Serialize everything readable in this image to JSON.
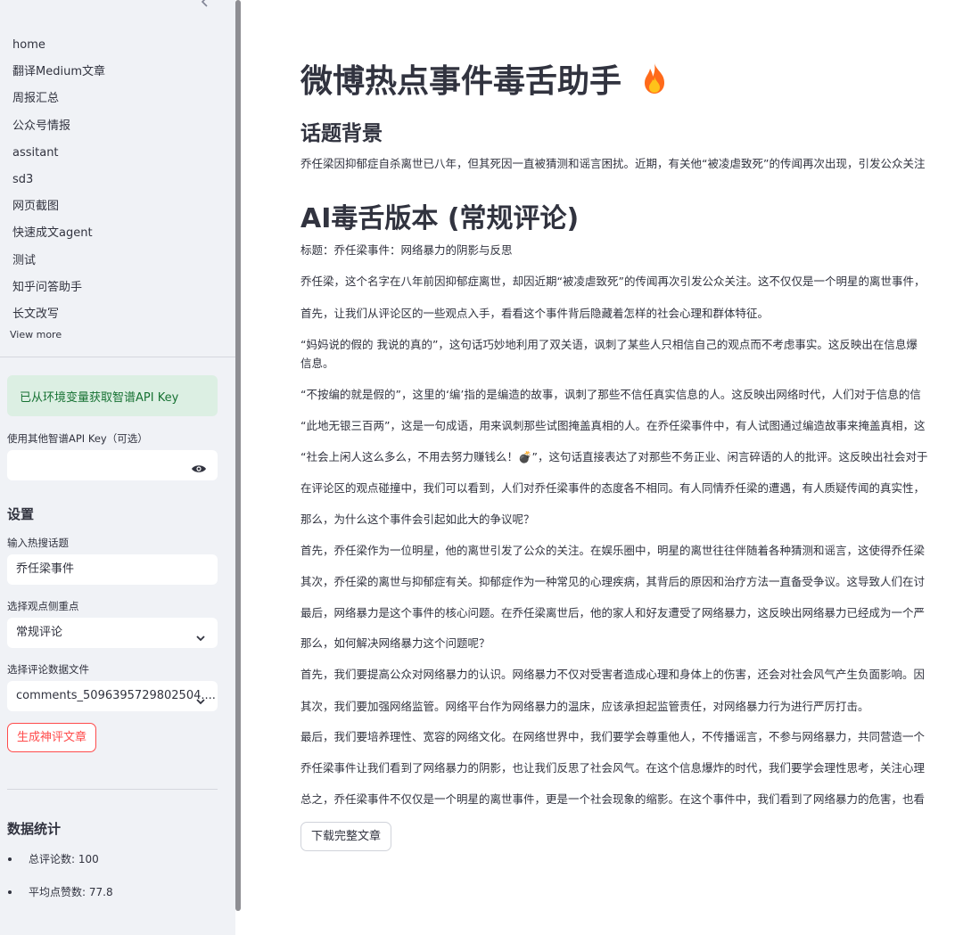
{
  "sidebar": {
    "nav_items": [
      "home",
      "翻译Medium文章",
      "周报汇总",
      "公众号情报",
      "assitant",
      "sd3",
      "网页截图",
      "快速成文agent",
      "测试",
      "知乎问答助手",
      "长文改写"
    ],
    "view_more": "View more",
    "success_message": "已从环境变量获取智谱API Key",
    "api_key_label": "使用其他智谱API Key（可选）",
    "api_key_value": "",
    "settings_heading": "设置",
    "topic_label": "输入热搜话题",
    "topic_value": "乔任梁事件",
    "focus_label": "选择观点侧重点",
    "focus_value": "常规评论",
    "file_label": "选择评论数据文件",
    "file_value": "comments_5096395729802504....",
    "generate_button": "生成神评文章",
    "stats_heading": "数据统计",
    "stats": [
      "总评论数: 100",
      "平均点赞数: 77.8"
    ]
  },
  "main": {
    "title": "微博热点事件毒舌助手",
    "background_heading": "话题背景",
    "background_text": "乔任梁因抑郁症自杀离世已八年，但其死因一直被猜测和谣言困扰。近期，有关他“被凌虐致死”的传闻再次出现，引发公众关注",
    "version_heading": "AI毒舌版本 (常规评论)",
    "article_title": "标题：乔任梁事件：网络暴力的阴影与反思",
    "paragraphs": [
      "乔任梁，这个名字在八年前因抑郁症离世，却因近期“被凌虐致死”的传闻再次引发公众关注。这不仅仅是一个明星的离世事件，",
      "首先，让我们从评论区的一些观点入手，看看这个事件背后隐藏着怎样的社会心理和群体特征。",
      "“妈妈说的假的 我说的真的”，这句话巧妙地利用了双关语，讽刺了某些人只相信自己的观点而不考虑事实。这反映出在信息爆",
      "信息。",
      "“不按编的就是假的”，这里的‘编’指的是编造的故事，讽刺了那些不信任真实信息的人。这反映出网络时代，人们对于信息的信",
      "“此地无银三百两”，这是一句成语，用来讽刺那些试图掩盖真相的人。在乔任梁事件中，有人试图通过编造故事来掩盖真相，这",
      "“社会上闲人这么多么，不用去努力赚钱么！💣”，这句话直接表达了对那些不务正业、闲言碎语的人的批评。这反映出社会对于",
      "在评论区的观点碰撞中，我们可以看到，人们对乔任梁事件的态度各不相同。有人同情乔任梁的遭遇，有人质疑传闻的真实性，",
      "那么，为什么这个事件会引起如此大的争议呢？",
      "首先，乔任梁作为一位明星，他的离世引发了公众的关注。在娱乐圈中，明星的离世往往伴随着各种猜测和谣言，这使得乔任梁",
      "其次，乔任梁的离世与抑郁症有关。抑郁症作为一种常见的心理疾病，其背后的原因和治疗方法一直备受争议。这导致人们在讨",
      "最后，网络暴力是这个事件的核心问题。在乔任梁离世后，他的家人和好友遭受了网络暴力，这反映出网络暴力已经成为一个严",
      "那么，如何解决网络暴力这个问题呢？",
      "首先，我们要提高公众对网络暴力的认识。网络暴力不仅对受害者造成心理和身体上的伤害，还会对社会风气产生负面影响。因",
      "其次，我们要加强网络监管。网络平台作为网络暴力的温床，应该承担起监管责任，对网络暴力行为进行严厉打击。",
      "最后，我们要培养理性、宽容的网络文化。在网络世界中，我们要学会尊重他人，不传播谣言，不参与网络暴力，共同营造一个",
      "乔任梁事件让我们看到了网络暴力的阴影，也让我们反思了社会风气。在这个信息爆炸的时代，我们要学会理性思考，关注心理",
      "总之，乔任梁事件不仅仅是一个明星的离世事件，更是一个社会现象的缩影。在这个事件中，我们看到了网络暴力的危害，也看"
    ],
    "download_button": "下载完整文章"
  },
  "icons": {
    "collapse": "chevron-left-icon",
    "eye": "eye-icon",
    "select": "chevron-down-icon",
    "title_emoji": "flame-icon"
  },
  "colors": {
    "sidebar_bg": "#f0f2f6",
    "accent": "#ff4b4b",
    "success_bg": "#dcefe3",
    "success_text": "#177233"
  }
}
